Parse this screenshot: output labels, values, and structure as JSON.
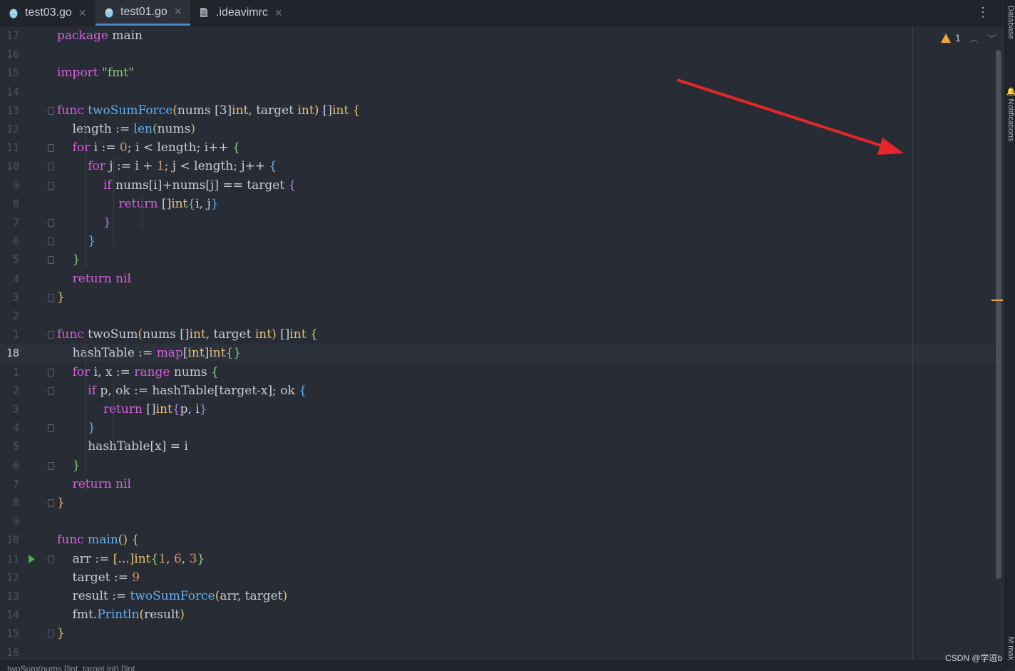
{
  "tabs": [
    {
      "label": "test03.go",
      "active": false,
      "icon": "go-gopher-icon"
    },
    {
      "label": "test01.go",
      "active": true,
      "icon": "go-gopher-icon"
    },
    {
      "label": ".ideavimrc",
      "active": false,
      "icon": "file-icon"
    }
  ],
  "tool_windows": {
    "database": "Database",
    "notifications": "Notifications",
    "bottom": "mak"
  },
  "inspection": {
    "warnings": "1"
  },
  "status_text": "twoSum(nums []int, target int) []int",
  "watermark": "CSDN @学逗b",
  "current_line": "18",
  "colors": {
    "accent": "#4a88c7",
    "warning": "#f0a732",
    "arrow": "#e5262a",
    "background": "#282c34"
  },
  "lines": [
    {
      "num": "17",
      "tokens": [
        [
          "package",
          "kw"
        ],
        [
          " main",
          "id"
        ]
      ]
    },
    {
      "num": "16",
      "tokens": []
    },
    {
      "num": "15",
      "tokens": [
        [
          "import",
          "kw"
        ],
        [
          " ",
          "id"
        ],
        [
          "\"fmt\"",
          "str"
        ]
      ]
    },
    {
      "num": "14",
      "tokens": []
    },
    {
      "num": "13",
      "tokens": [
        [
          "func",
          "kw"
        ],
        [
          " ",
          "id"
        ],
        [
          "twoSumForce",
          "fn"
        ],
        [
          "(",
          "b1"
        ],
        [
          "nums ",
          "id"
        ],
        [
          "[3]",
          "id"
        ],
        [
          "int",
          "ty"
        ],
        [
          ", target ",
          "id"
        ],
        [
          "int",
          "ty"
        ],
        [
          ")",
          "b1"
        ],
        [
          " ",
          "id"
        ],
        [
          "[]",
          "id"
        ],
        [
          "int",
          "ty"
        ],
        [
          " ",
          "id"
        ],
        [
          "{",
          "b1"
        ]
      ]
    },
    {
      "num": "12",
      "tokens": [
        [
          "    length := ",
          "id"
        ],
        [
          "len",
          "fn"
        ],
        [
          "(",
          "b2"
        ],
        [
          "nums",
          "id"
        ],
        [
          ")",
          "b2"
        ]
      ]
    },
    {
      "num": "11",
      "tokens": [
        [
          "    ",
          "id"
        ],
        [
          "for",
          "kw"
        ],
        [
          " i := ",
          "id"
        ],
        [
          "0",
          "num"
        ],
        [
          "; i < length; i++ ",
          "id"
        ],
        [
          "{",
          "b2"
        ]
      ]
    },
    {
      "num": "10",
      "tokens": [
        [
          "        ",
          "id"
        ],
        [
          "for",
          "kw"
        ],
        [
          " j := i + ",
          "id"
        ],
        [
          "1",
          "num"
        ],
        [
          "; j < length; j++ ",
          "id"
        ],
        [
          "{",
          "b3"
        ]
      ]
    },
    {
      "num": "9",
      "tokens": [
        [
          "            ",
          "id"
        ],
        [
          "if",
          "kw"
        ],
        [
          " nums[i]+nums[j] == target ",
          "id"
        ],
        [
          "{",
          "b4"
        ]
      ]
    },
    {
      "num": "8",
      "tokens": [
        [
          "                ",
          "id"
        ],
        [
          "return",
          "kw"
        ],
        [
          " []",
          "id"
        ],
        [
          "int",
          "ty"
        ],
        [
          "{",
          "b3"
        ],
        [
          "i, j",
          "id"
        ],
        [
          "}",
          "b3"
        ]
      ]
    },
    {
      "num": "7",
      "tokens": [
        [
          "            ",
          "id"
        ],
        [
          "}",
          "b4"
        ]
      ]
    },
    {
      "num": "6",
      "tokens": [
        [
          "        ",
          "id"
        ],
        [
          "}",
          "b3"
        ]
      ]
    },
    {
      "num": "5",
      "tokens": [
        [
          "    ",
          "id"
        ],
        [
          "}",
          "b2"
        ]
      ]
    },
    {
      "num": "4",
      "tokens": [
        [
          "    ",
          "id"
        ],
        [
          "return",
          "kw"
        ],
        [
          " ",
          "id"
        ],
        [
          "nil",
          "kw"
        ]
      ]
    },
    {
      "num": "3",
      "tokens": [
        [
          "}",
          "b1"
        ]
      ]
    },
    {
      "num": "2",
      "tokens": []
    },
    {
      "num": "1",
      "tokens": [
        [
          "func",
          "kw"
        ],
        [
          " twoSum",
          "id"
        ],
        [
          "(",
          "b1"
        ],
        [
          "nums ",
          "id"
        ],
        [
          "[]",
          "id"
        ],
        [
          "int",
          "ty"
        ],
        [
          ", target ",
          "id"
        ],
        [
          "int",
          "ty"
        ],
        [
          ")",
          "b1"
        ],
        [
          " ",
          "id"
        ],
        [
          "[]",
          "id"
        ],
        [
          "int",
          "ty"
        ],
        [
          " ",
          "id"
        ],
        [
          "{",
          "b1"
        ]
      ]
    },
    {
      "num": "18",
      "tokens": [
        [
          "    hashTable := ",
          "id"
        ],
        [
          "map",
          "kw"
        ],
        [
          "[",
          "id"
        ],
        [
          "int",
          "ty"
        ],
        [
          "]",
          "id"
        ],
        [
          "int",
          "ty"
        ],
        [
          "{}",
          "b2"
        ]
      ]
    },
    {
      "num": "1",
      "tokens": [
        [
          "    ",
          "id"
        ],
        [
          "for",
          "kw"
        ],
        [
          " i, x := ",
          "id"
        ],
        [
          "range",
          "kw"
        ],
        [
          " nums ",
          "id"
        ],
        [
          "{",
          "b2"
        ]
      ]
    },
    {
      "num": "2",
      "tokens": [
        [
          "        ",
          "id"
        ],
        [
          "if",
          "kw"
        ],
        [
          " p, ok := hashTable[target-x]; ok ",
          "id"
        ],
        [
          "{",
          "b3"
        ]
      ]
    },
    {
      "num": "3",
      "tokens": [
        [
          "            ",
          "id"
        ],
        [
          "return",
          "kw"
        ],
        [
          " []",
          "id"
        ],
        [
          "int",
          "ty"
        ],
        [
          "{",
          "b4"
        ],
        [
          "p, i",
          "id"
        ],
        [
          "}",
          "b4"
        ]
      ]
    },
    {
      "num": "4",
      "tokens": [
        [
          "        ",
          "id"
        ],
        [
          "}",
          "b3"
        ]
      ]
    },
    {
      "num": "5",
      "tokens": [
        [
          "        hashTable[x] = i",
          "id"
        ]
      ]
    },
    {
      "num": "6",
      "tokens": [
        [
          "    ",
          "id"
        ],
        [
          "}",
          "b2"
        ]
      ]
    },
    {
      "num": "7",
      "tokens": [
        [
          "    ",
          "id"
        ],
        [
          "return",
          "kw"
        ],
        [
          " ",
          "id"
        ],
        [
          "nil",
          "kw"
        ]
      ]
    },
    {
      "num": "8",
      "tokens": [
        [
          "}",
          "b1"
        ]
      ]
    },
    {
      "num": "9",
      "tokens": []
    },
    {
      "num": "10",
      "tokens": [
        [
          "func",
          "kw"
        ],
        [
          " ",
          "id"
        ],
        [
          "main",
          "fn"
        ],
        [
          "()",
          "b1"
        ],
        [
          " ",
          "id"
        ],
        [
          "{",
          "b1"
        ]
      ]
    },
    {
      "num": "11",
      "tokens": [
        [
          "    arr := ",
          "id"
        ],
        [
          "[...]",
          "b1"
        ],
        [
          "int",
          "ty"
        ],
        [
          "{",
          "b2"
        ],
        [
          "1",
          "num"
        ],
        [
          ", ",
          "id"
        ],
        [
          "6",
          "num"
        ],
        [
          ", ",
          "id"
        ],
        [
          "3",
          "num"
        ],
        [
          "}",
          "b2"
        ]
      ]
    },
    {
      "num": "12",
      "tokens": [
        [
          "    target := ",
          "id"
        ],
        [
          "9",
          "num"
        ]
      ]
    },
    {
      "num": "13",
      "tokens": [
        [
          "    result := ",
          "id"
        ],
        [
          "twoSumForce",
          "fn"
        ],
        [
          "(",
          "b1"
        ],
        [
          "arr, target",
          "id"
        ],
        [
          ")",
          "b1"
        ]
      ]
    },
    {
      "num": "14",
      "tokens": [
        [
          "    fmt.",
          "id"
        ],
        [
          "Println",
          "fn"
        ],
        [
          "(",
          "b1"
        ],
        [
          "result",
          "id"
        ],
        [
          ")",
          "b1"
        ]
      ]
    },
    {
      "num": "15",
      "tokens": [
        [
          "}",
          "b1"
        ]
      ]
    },
    {
      "num": "16",
      "tokens": []
    }
  ]
}
